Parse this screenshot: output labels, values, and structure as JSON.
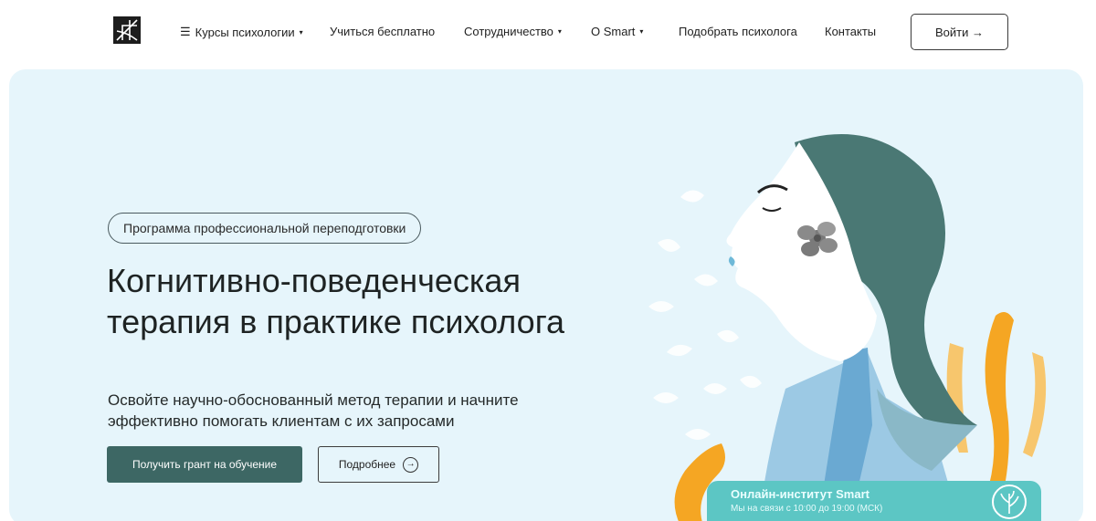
{
  "header": {
    "nav": [
      {
        "label": "Курсы психологии",
        "has_menu_icon": true,
        "has_dropdown": true
      },
      {
        "label": "Учиться бесплатно",
        "has_dropdown": false
      },
      {
        "label": "Сотрудничество",
        "has_dropdown": true
      },
      {
        "label": "О Smart",
        "has_dropdown": true
      },
      {
        "label": "Подобрать психолога",
        "has_dropdown": false
      },
      {
        "label": "Контакты",
        "has_dropdown": false
      }
    ],
    "login_label": "Войти →",
    "menu_glyph": "☰",
    "caret_glyph": "▾"
  },
  "hero": {
    "badge": "Программа профессиональной переподготовки",
    "title_line1": "Когнитивно-поведенческая",
    "title_line2": "терапия в практике психолога",
    "subtitle_line1": "Освойте научно-обоснованный метод терапии и начните",
    "subtitle_line2": "эффективно помогать клиентам с их запросами",
    "primary_button": "Получить грант на обучение",
    "secondary_button": "Подробнее"
  },
  "chat_widget": {
    "title": "Онлайн-институт Smart",
    "subtitle": "Мы на связи с 10:00 до 19:00 (МСК)"
  },
  "colors": {
    "hero_bg": "#e6f5fb",
    "primary": "#3d6764",
    "chat": "#5cc6c4",
    "hair": "#4a7874",
    "orange": "#f5a623"
  },
  "icons": [
    "logo-icon",
    "menu-icon",
    "chevron-down-icon",
    "arrow-right-icon",
    "circle-arrow-icon",
    "tree-logo-icon"
  ]
}
